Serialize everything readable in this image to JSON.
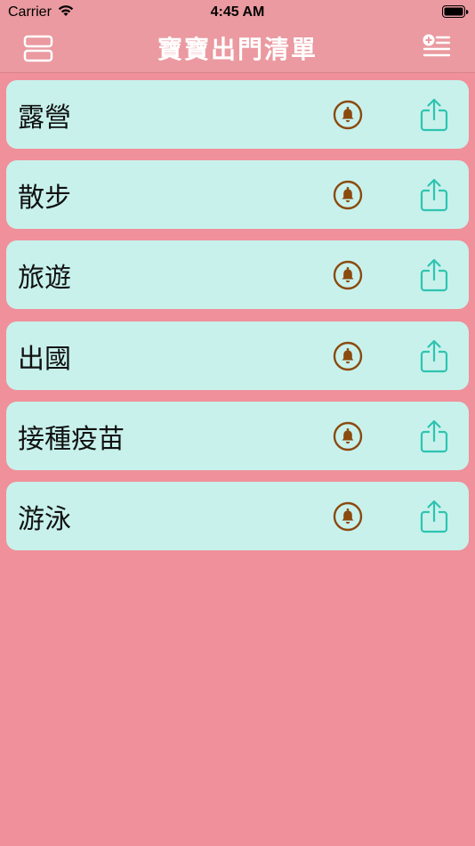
{
  "status_bar": {
    "carrier": "Carrier",
    "time": "4:45 AM"
  },
  "nav": {
    "title": "寶寶出門清單",
    "left_icon": "layout-rows-icon",
    "right_icon": "add-list-icon"
  },
  "colors": {
    "background": "#F0909A",
    "nav_background": "#EA9AA0",
    "card_background": "#C8F1EC",
    "bell_color": "#8B4A0E",
    "share_color": "#2EC4B0"
  },
  "items": [
    {
      "label": "露營"
    },
    {
      "label": "散步"
    },
    {
      "label": "旅遊"
    },
    {
      "label": "出國"
    },
    {
      "label": "接種疫苗"
    },
    {
      "label": "游泳"
    }
  ]
}
